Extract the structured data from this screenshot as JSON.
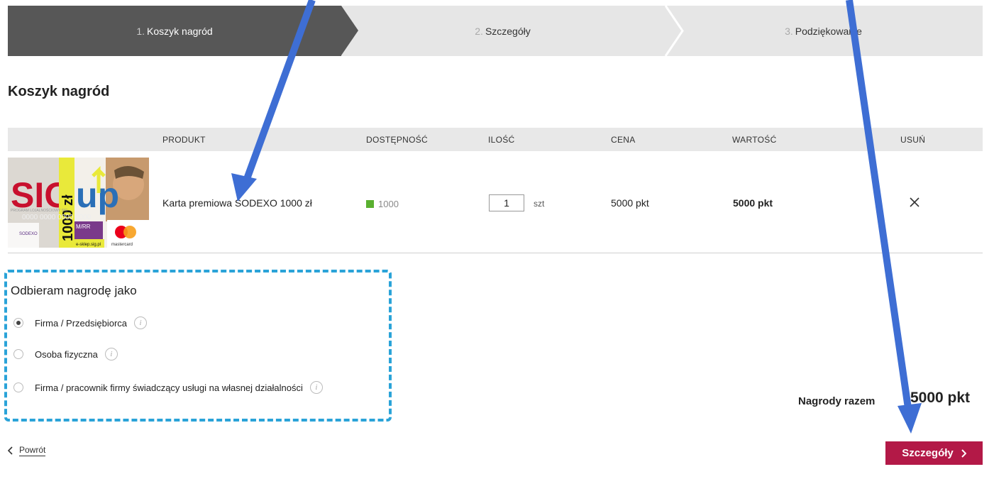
{
  "stepper": {
    "steps": [
      {
        "num": "1.",
        "label": "Koszyk nagród"
      },
      {
        "num": "2.",
        "label": "Szczegóły"
      },
      {
        "num": "3.",
        "label": "Podziękowanie"
      }
    ]
  },
  "page": {
    "title": "Koszyk nagród"
  },
  "table": {
    "headers": {
      "product": "PRODUKT",
      "availability": "DOSTĘPNOŚĆ",
      "quantity": "ILOŚĆ",
      "price": "CENA",
      "value": "WARTOŚĆ",
      "remove": "USUŃ"
    },
    "rows": [
      {
        "card": {
          "brand": "SIG",
          "up": "up",
          "amount": "1000 zł",
          "program": "PROGRAM LOJALNOŚCIOWY SIG",
          "number": "0000 0000 0000 0000",
          "exp": "M/RR",
          "issuer": "SODEXO",
          "site": "e-sklep.sig.pl",
          "network": "mastercard"
        },
        "name": "Karta premiowa SODEXO 1000 zł",
        "availability": "1000",
        "quantity": "1",
        "unit": "szt",
        "price": "5000 pkt",
        "value": "5000 pkt"
      }
    ]
  },
  "receipt": {
    "title": "Odbieram nagrodę jako",
    "options": [
      {
        "label": "Firma / Przedsiębiorca",
        "selected": true
      },
      {
        "label": "Osoba fizyczna",
        "selected": false
      },
      {
        "label": "Firma / pracownik firmy świadczący usługi na własnej działalności",
        "selected": false
      }
    ]
  },
  "summary": {
    "label": "Nagrody razem",
    "total": "5000  pkt"
  },
  "nav": {
    "back_label": "Powrót",
    "next_label": "Szczegóły"
  },
  "colors": {
    "accent": "#b31947",
    "active_step": "#575757",
    "annotation_box": "#2aa3d8",
    "annotation_arrow": "#3e6ed4",
    "available": "#5ab030"
  }
}
